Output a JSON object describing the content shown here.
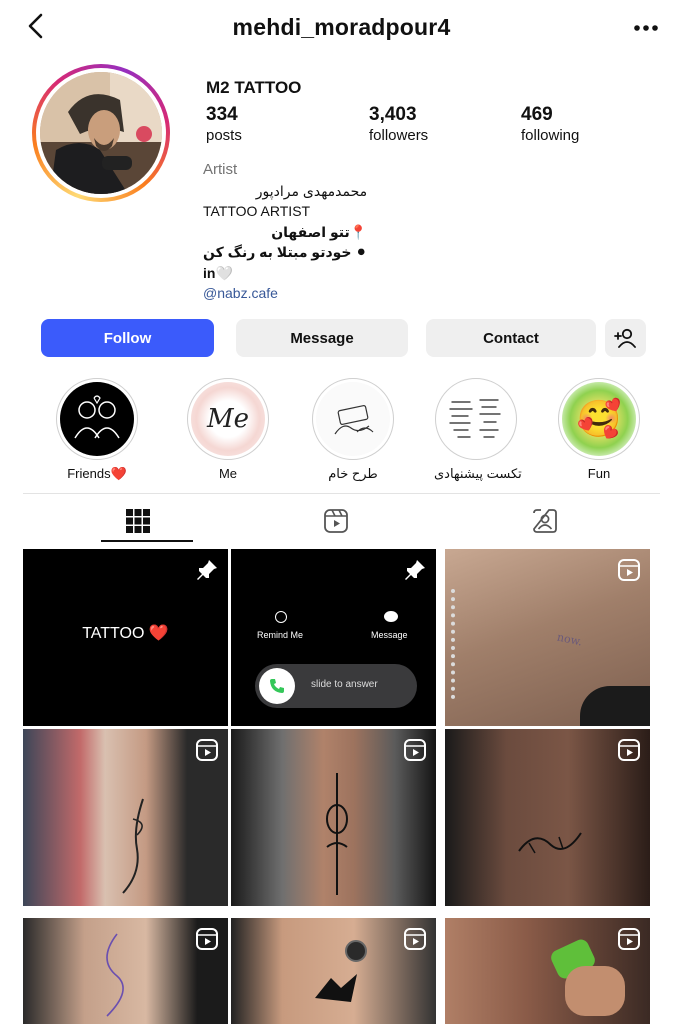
{
  "header": {
    "username": "mehdi_moradpour4"
  },
  "profile": {
    "display_name": "M2 TATTOO",
    "stats": [
      {
        "value": "334",
        "label": "posts"
      },
      {
        "value": "3,403",
        "label": "followers"
      },
      {
        "value": "469",
        "label": "following"
      }
    ],
    "bio": {
      "category": "Artist",
      "line1": "محمدمهدی مرادپور",
      "line2": "TATTOO ARTIST",
      "line3": "📍تتو اصفهان",
      "line4": "⚫ خودتو مبتلا به رنگ کن",
      "line5": "in🤍",
      "link": "@nabz.cafe"
    }
  },
  "actions": {
    "follow": "Follow",
    "message": "Message",
    "contact": "Contact"
  },
  "highlights": [
    {
      "label": "Friends❤️"
    },
    {
      "label": "Me",
      "cover_text": "Me"
    },
    {
      "label": "طرح خام"
    },
    {
      "label": "تکست پیشنهادی"
    },
    {
      "label": "Fun",
      "cover_text": "🥰"
    }
  ],
  "tabs": [
    "grid-icon",
    "reels-icon",
    "tagged-icon"
  ],
  "posts": {
    "p1_text": "TATTOO ❤️",
    "p2_remind": "Remind Me",
    "p2_message": "Message",
    "p2_slide": "slide to answer",
    "p3_tattoo_text": "now."
  }
}
